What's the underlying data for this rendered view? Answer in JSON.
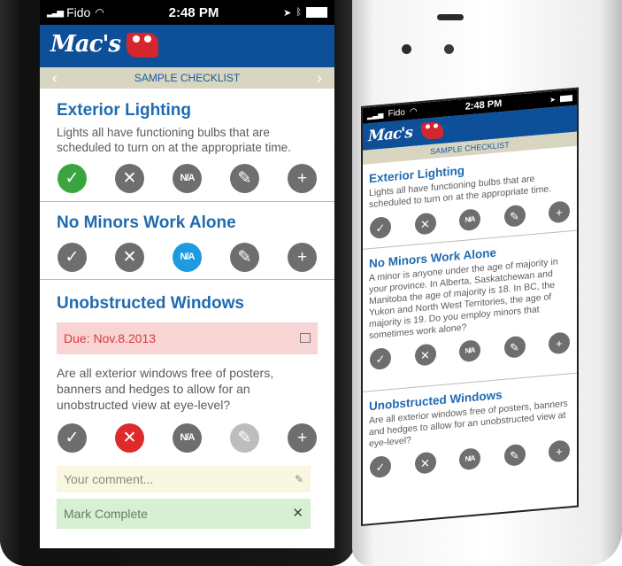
{
  "status": {
    "carrier": "Fido",
    "time": "2:48 PM"
  },
  "brand": {
    "logo_text": "Mac's",
    "color": "#0d4f99",
    "accent": "#d6262d"
  },
  "nav": {
    "title": "SAMPLE CHECKLIST",
    "prev_icon": "chevron-left-icon",
    "next_icon": "chevron-right-icon"
  },
  "buttons": {
    "check": "✓",
    "cross": "✕",
    "na": "N/A",
    "edit": "✎",
    "add": "+"
  },
  "front": {
    "items": [
      {
        "title": "Exterior Lighting",
        "description": "Lights all have functioning bulbs that are scheduled to turn on at the appropriate time.",
        "state": "checked"
      },
      {
        "title": "No Minors Work Alone",
        "description": "",
        "state": "na"
      },
      {
        "title": "Unobstructed Windows",
        "due": "Due: Nov.8.2013",
        "description": "Are all exterior windows free of posters, banners and hedges to allow for an unobstructed view at eye-level?",
        "state": "failed",
        "comment_placeholder": "Your comment...",
        "mark_complete": "Mark Complete"
      }
    ]
  },
  "back": {
    "items": [
      {
        "title": "Exterior Lighting",
        "description": "Lights all have functioning bulbs that are scheduled to turn on at the appropriate time."
      },
      {
        "title": "No Minors Work Alone",
        "description": "A minor is anyone under the age of majority in your province. In Alberta, Saskatchewan and Manitoba the age of majority is 18. In BC, the Yukon and North West Territories, the age of majority is 19. Do you employ minors that sometimes work alone?"
      },
      {
        "title": "Unobstructed Windows",
        "description": "Are all exterior windows free of posters, banners and hedges to allow for an unobstructed view at eye-level?"
      }
    ]
  }
}
